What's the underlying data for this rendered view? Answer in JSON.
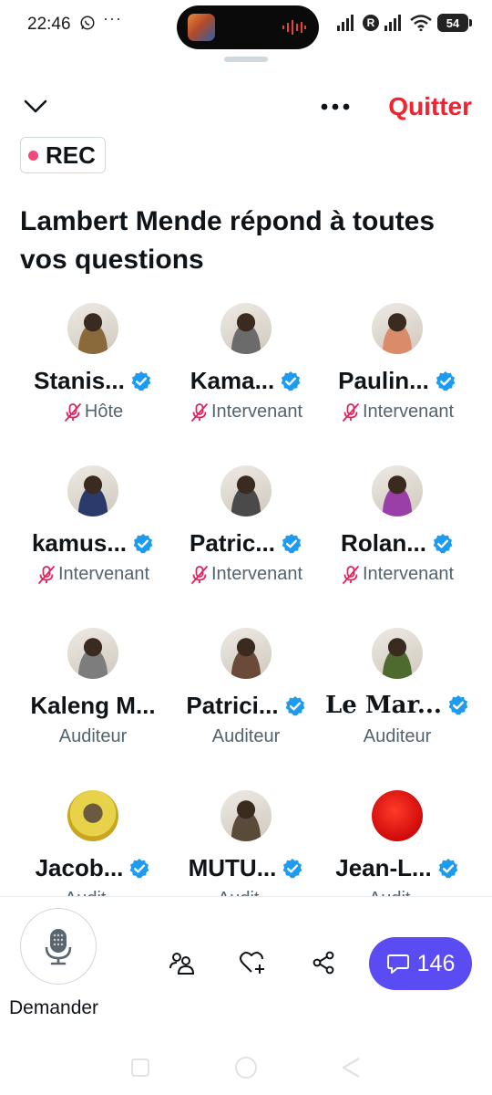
{
  "status_bar": {
    "time": "22:46",
    "more": "···",
    "r_badge": "R",
    "battery": "54",
    "icons": [
      "whatsapp-icon",
      "signal-icon",
      "wifi-icon",
      "battery-icon"
    ]
  },
  "header": {
    "quit_label": "Quitter",
    "rec_label": "REC",
    "title": "Lambert Mende répond à toutes vos questions"
  },
  "participants": [
    {
      "name": "Stanis...",
      "role": "Hôte",
      "verified": true,
      "muted": true,
      "avatar": "#8a6a3a"
    },
    {
      "name": "Kama...",
      "role": "Intervenant",
      "verified": true,
      "muted": true,
      "avatar": "#6b6b6b"
    },
    {
      "name": "Paulin...",
      "role": "Intervenant",
      "verified": true,
      "muted": true,
      "avatar": "#d98b6a"
    },
    {
      "name": "kamus...",
      "role": "Intervenant",
      "verified": true,
      "muted": true,
      "avatar": "#2b3a6b"
    },
    {
      "name": "Patric...",
      "role": "Intervenant",
      "verified": true,
      "muted": true,
      "avatar": "#4a4a4a"
    },
    {
      "name": "Rolan...",
      "role": "Intervenant",
      "verified": true,
      "muted": true,
      "avatar": "#9a3fa8"
    },
    {
      "name": "Kaleng M...",
      "role": "Auditeur",
      "verified": false,
      "muted": false,
      "avatar": "#7d7d7d"
    },
    {
      "name": "Patrici...",
      "role": "Auditeur",
      "verified": true,
      "muted": false,
      "avatar": "#6b4a3a"
    },
    {
      "name": "Le Mar...",
      "role": "Auditeur",
      "verified": true,
      "muted": false,
      "avatar": "#4f6a2e"
    },
    {
      "name": "Jacob...",
      "role": "Audit...",
      "verified": true,
      "muted": false,
      "avatar": "#e0c23a"
    },
    {
      "name": "MUTU...",
      "role": "Audit...",
      "verified": true,
      "muted": false,
      "avatar": "#5a4a3a"
    },
    {
      "name": "Jean-L...",
      "role": "Audit...",
      "verified": true,
      "muted": false,
      "avatar": "#e01010"
    }
  ],
  "bottom_bar": {
    "ask_label": "Demander",
    "comments_count": "146"
  },
  "colors": {
    "accent": "#5a4bf2",
    "quit": "#f4212e",
    "rec_dot": "#f2497a",
    "verified": "#1d9bf0",
    "muted": "#e0245e"
  }
}
